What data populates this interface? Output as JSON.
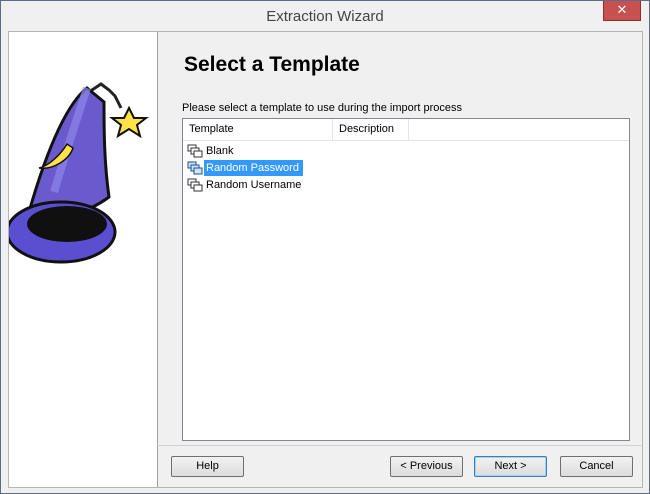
{
  "window": {
    "title": "Extraction Wizard",
    "close_glyph": "✕"
  },
  "page": {
    "heading": "Select a Template",
    "instruction": "Please select a template to use during the import process"
  },
  "listview": {
    "columns": [
      "Template",
      "Description"
    ],
    "items": [
      {
        "label": "Blank",
        "icon": "template-icon",
        "selected": false
      },
      {
        "label": "Random Password",
        "icon": "template-icon",
        "selected": true
      },
      {
        "label": "Random Username",
        "icon": "template-icon",
        "selected": false
      }
    ]
  },
  "buttons": {
    "help": "Help",
    "previous": "< Previous",
    "next": "Next >",
    "cancel": "Cancel"
  },
  "colors": {
    "selection": "#3399ff",
    "hat": "#6a5acd",
    "star": "#ffe14a"
  }
}
